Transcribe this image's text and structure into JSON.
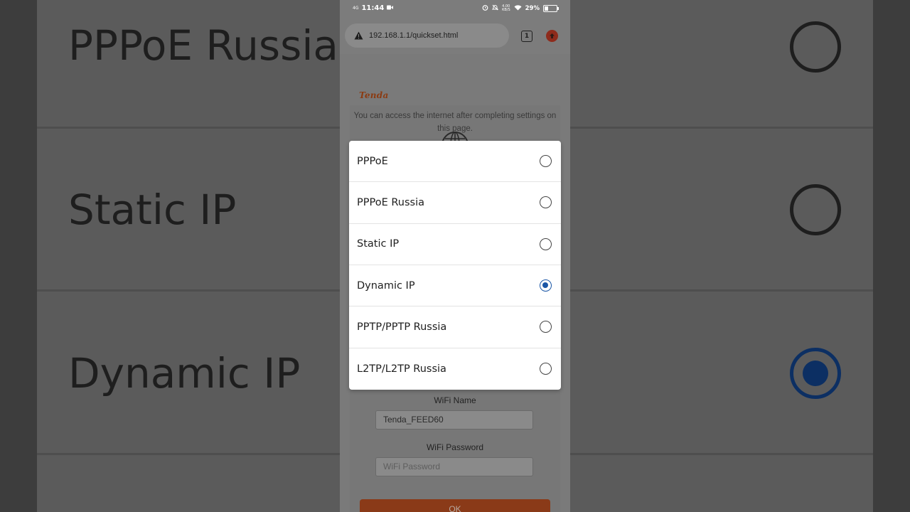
{
  "status_bar": {
    "network": "4G",
    "time": "11:44",
    "data_speed": "4.00\nKB/S",
    "battery": "29%"
  },
  "browser": {
    "url": "192.168.1.1/quickset.html",
    "tab_count": "1"
  },
  "page": {
    "brand": "Tenda",
    "intro": "You can access the internet after completing settings on this page.",
    "wifi_name_label": "WiFi Name",
    "wifi_name_value": "Tenda_FEED60",
    "wifi_password_label": "WiFi Password",
    "wifi_password_placeholder": "WiFi Password",
    "ok_label": "OK"
  },
  "dialog": {
    "options": [
      {
        "label": "PPPoE",
        "selected": false
      },
      {
        "label": "PPPoE Russia",
        "selected": false
      },
      {
        "label": "Static IP",
        "selected": false
      },
      {
        "label": "Dynamic IP",
        "selected": true
      },
      {
        "label": "PPTP/PPTP Russia",
        "selected": false
      },
      {
        "label": "L2TP/L2TP Russia",
        "selected": false
      }
    ]
  },
  "background_zoom": {
    "rows": [
      "PPPoE Russia",
      "Static IP",
      "Dynamic IP"
    ]
  },
  "colors": {
    "accent": "#1a56a6",
    "brand": "#e46a1f",
    "ok_button": "#e1642a"
  }
}
